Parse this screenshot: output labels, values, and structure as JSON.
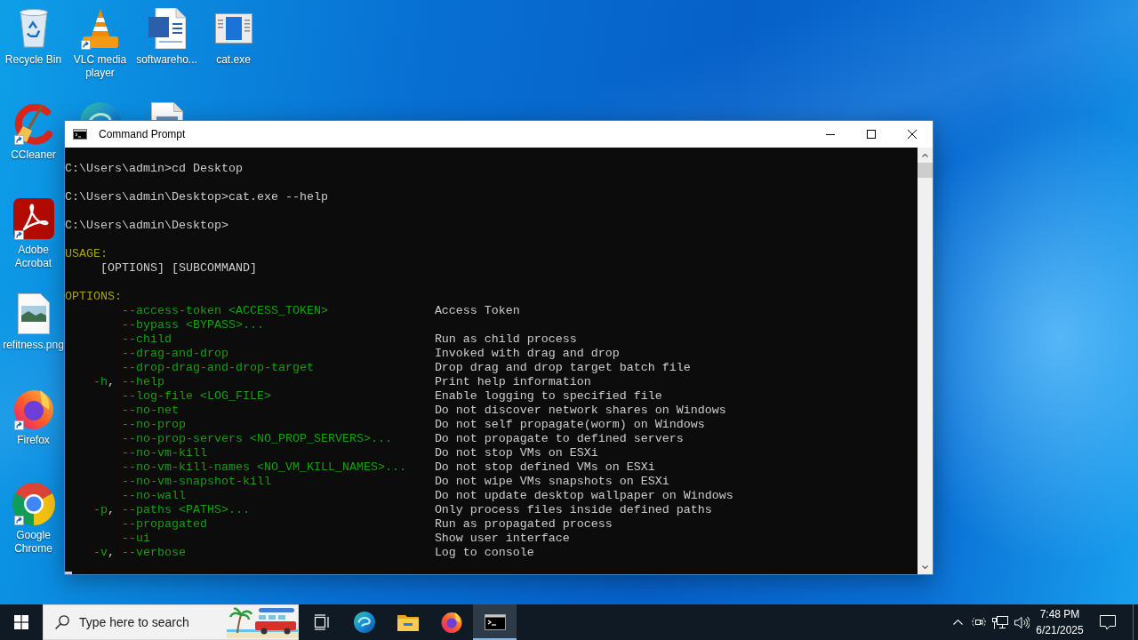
{
  "desktop": {
    "columns": [
      {
        "icons": [
          {
            "kind": "recycle-bin",
            "label": "Recycle Bin",
            "shortcut": false
          },
          {
            "kind": "ccleaner",
            "label": "CCleaner",
            "shortcut": true
          },
          {
            "kind": "acrobat",
            "label": "Adobe Acrobat",
            "shortcut": true
          },
          {
            "kind": "image-file",
            "label": "refitness.png",
            "shortcut": false
          },
          {
            "kind": "firefox",
            "label": "Firefox",
            "shortcut": true
          },
          {
            "kind": "chrome",
            "label": "Google Chrome",
            "shortcut": true
          }
        ]
      },
      {
        "icons": [
          {
            "kind": "vlc",
            "label": "VLC media player",
            "shortcut": true
          },
          {
            "kind": "edge",
            "shortcut": false
          }
        ]
      },
      {
        "icons": [
          {
            "kind": "word-document",
            "label": "softwareho...",
            "shortcut": false
          },
          {
            "kind": "text-document",
            "shortcut": false
          }
        ]
      },
      {
        "icons": [
          {
            "kind": "app-window",
            "label": "cat.exe",
            "shortcut": false
          }
        ]
      }
    ]
  },
  "window": {
    "title": "Command Prompt",
    "console": {
      "lines": [
        {
          "kind": "command",
          "text": "C:\\Users\\admin>cd Desktop"
        },
        {
          "kind": "command",
          "text": "C:\\Users\\admin\\Desktop>cat.exe --help"
        },
        {
          "kind": "command",
          "text": "C:\\Users\\admin\\Desktop>"
        },
        {
          "kind": "heading",
          "text": "USAGE:"
        },
        {
          "kind": "usage",
          "text": "[OPTIONS] [SUBCOMMAND]"
        },
        {
          "kind": "heading",
          "text": "OPTIONS:"
        },
        {
          "kind": "option",
          "flag": "--access-token <ACCESS_TOKEN>",
          "description": "Access Token"
        },
        {
          "kind": "option",
          "flag": "--bypass <BYPASS>..."
        },
        {
          "kind": "option",
          "flag": "--child",
          "description": "Run as child process"
        },
        {
          "kind": "option",
          "flag": "--drag-and-drop",
          "description": "Invoked with drag and drop"
        },
        {
          "kind": "option",
          "flag": "--drop-drag-and-drop-target",
          "description": "Drop drag and drop target batch file"
        },
        {
          "kind": "option",
          "short": "-h",
          "separator": ",",
          "flag": "--help",
          "description": "Print help information"
        },
        {
          "kind": "option",
          "flag": "--log-file <LOG_FILE>",
          "description": "Enable logging to specified file"
        },
        {
          "kind": "option",
          "flag": "--no-net",
          "description": "Do not discover network shares on Windows"
        },
        {
          "kind": "option",
          "flag": "--no-prop",
          "description": "Do not self propagate(worm) on Windows"
        },
        {
          "kind": "option",
          "flag": "--no-prop-servers <NO_PROP_SERVERS>...",
          "description": "Do not propagate to defined servers"
        },
        {
          "kind": "option",
          "flag": "--no-vm-kill",
          "description": "Do not stop VMs on ESXi"
        },
        {
          "kind": "option",
          "flag": "--no-vm-kill-names <NO_VM_KILL_NAMES>...",
          "description": "Do not stop defined VMs on ESXi"
        },
        {
          "kind": "option",
          "flag": "--no-vm-snapshot-kill",
          "description": "Do not wipe VMs snapshots on ESXi"
        },
        {
          "kind": "option",
          "flag": "--no-wall",
          "description": "Do not update desktop wallpaper on Windows"
        },
        {
          "kind": "option",
          "short": "-p",
          "separator": ",",
          "flag": "--paths <PATHS>...",
          "description": "Only process files inside defined paths"
        },
        {
          "kind": "option",
          "flag": "--propagated",
          "description": "Run as propagated process"
        },
        {
          "kind": "option",
          "flag": "--ui",
          "description": "Show user interface"
        },
        {
          "kind": "option",
          "short": "-v",
          "separator": ",",
          "flag": "--verbose",
          "description": "Log to console"
        }
      ]
    }
  },
  "taskbar": {
    "search": {
      "placeholder": "Type here to search"
    },
    "apps": [
      {
        "kind": "task-view",
        "selected": false
      },
      {
        "kind": "edge",
        "selected": false
      },
      {
        "kind": "file-explorer",
        "selected": false
      },
      {
        "kind": "firefox",
        "selected": false
      },
      {
        "kind": "command-prompt",
        "selected": true
      }
    ],
    "clock": {
      "time": "7:48 PM",
      "date": "6/21/2025"
    }
  }
}
